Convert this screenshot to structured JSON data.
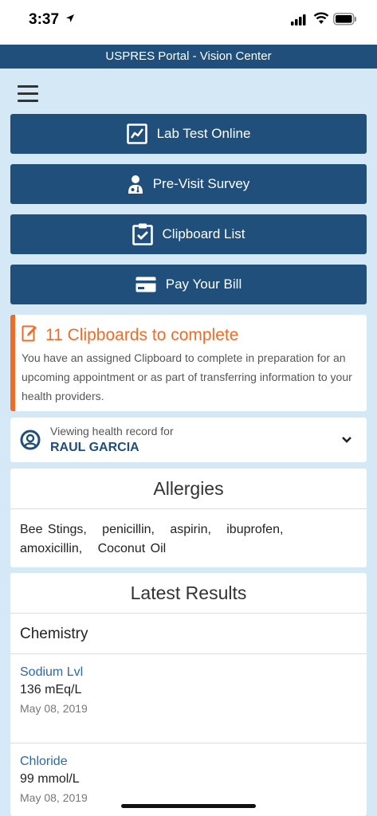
{
  "status_bar": {
    "time": "3:37"
  },
  "header": {
    "title": "USPRES Portal - Vision Center"
  },
  "nav_buttons": [
    {
      "label": "Lab Test Online",
      "icon": "chart-icon"
    },
    {
      "label": "Pre-Visit Survey",
      "icon": "doctor-icon"
    },
    {
      "label": "Clipboard List",
      "icon": "clipboard-check-icon"
    },
    {
      "label": "Pay Your Bill",
      "icon": "credit-card-icon"
    }
  ],
  "alert": {
    "title": "11 Clipboards to complete",
    "body": "You have an assigned Clipboard to complete in preparation for an upcoming appointment or as part of transferring information to your health providers.",
    "accent": "#ee6c28"
  },
  "viewing": {
    "label": "Viewing health record for",
    "name": "RAUL GARCIA"
  },
  "allergies": {
    "title": "Allergies",
    "items": [
      "Bee Stings",
      "penicillin",
      "aspirin",
      "ibuprofen",
      "amoxicillin",
      "Coconut Oil"
    ]
  },
  "results": {
    "title": "Latest Results",
    "section": "Chemistry",
    "items": [
      {
        "name": "Sodium Lvl",
        "value": "136 mEq/L",
        "date": "May 08, 2019"
      },
      {
        "name": "Chloride",
        "value": "99 mmol/L",
        "date": "May 08, 2019"
      }
    ]
  },
  "colors": {
    "primary": "#1f4f7a",
    "background": "#d4e8f5",
    "link": "#2a6aa6"
  }
}
